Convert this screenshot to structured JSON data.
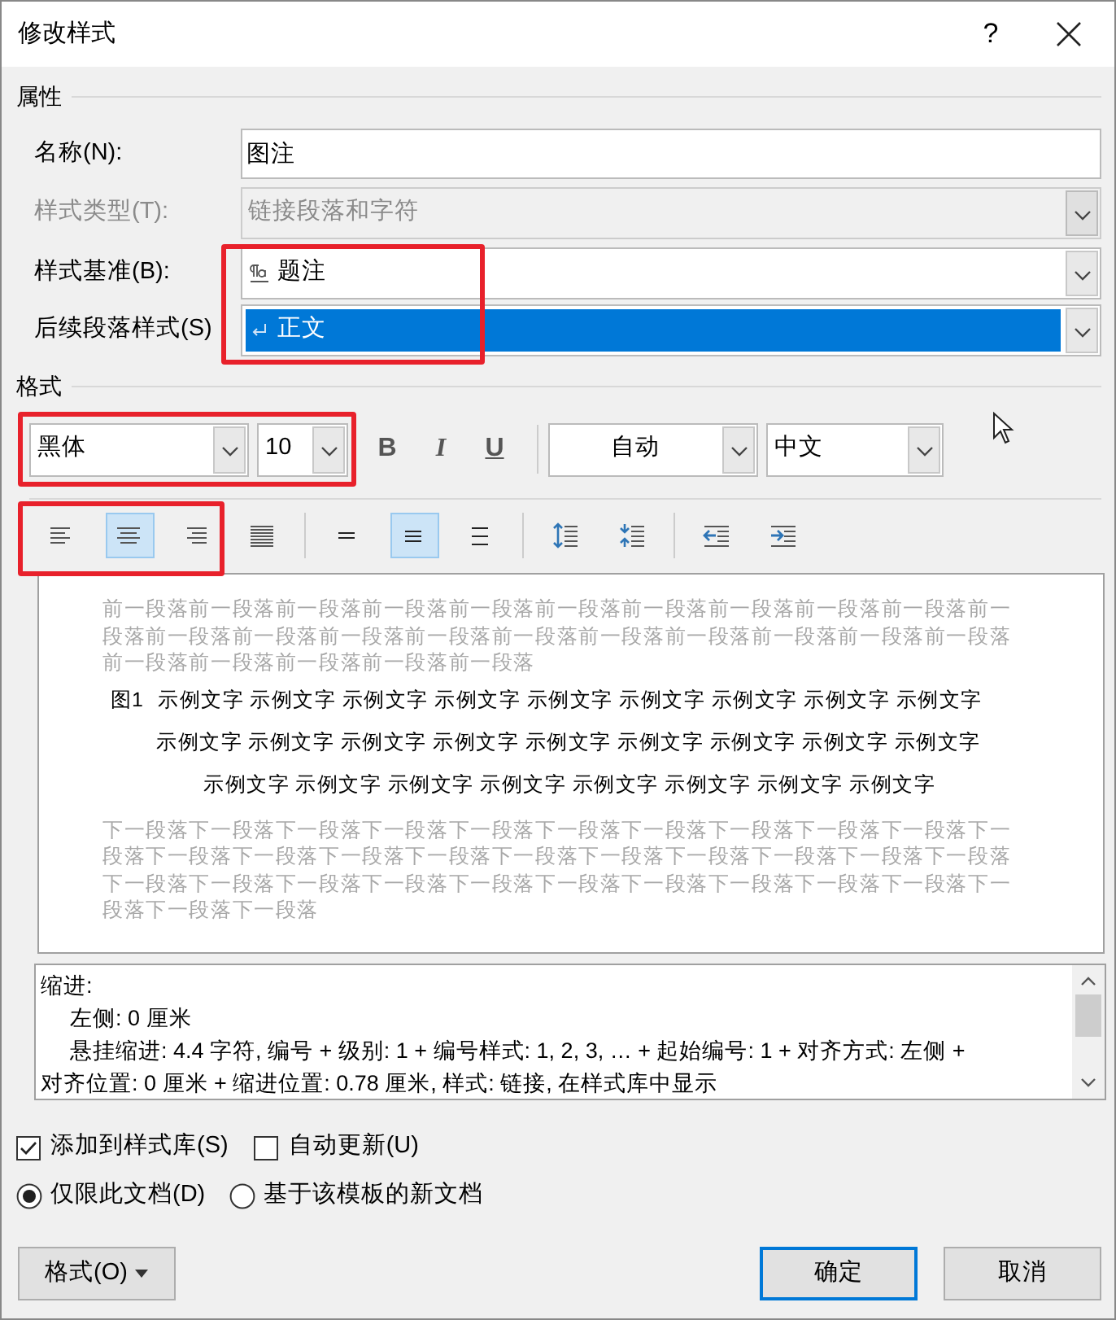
{
  "window": {
    "title": "修改样式",
    "help": "?"
  },
  "properties": {
    "heading": "属性",
    "name": {
      "label": "名称(N):",
      "value": "图注"
    },
    "style_type": {
      "label": "样式类型(T):",
      "value": "链接段落和字符",
      "disabled": true
    },
    "based_on": {
      "label": "样式基准(B):",
      "value": "题注",
      "selected": false
    },
    "next_style": {
      "label": "后续段落样式(S)",
      "value": "正文",
      "selected": true
    }
  },
  "formatting": {
    "heading": "格式",
    "font": "黑体",
    "size": "10",
    "style_buttons": [
      {
        "label": "B",
        "kind": "bold"
      },
      {
        "label": "I",
        "kind": "italic"
      },
      {
        "label": "U",
        "kind": "underline"
      }
    ],
    "font_color": "自动",
    "language": "中文",
    "paragraph_groups": [
      [
        {
          "kind": "left",
          "selected": false
        },
        {
          "kind": "center",
          "selected": true
        },
        {
          "kind": "right",
          "selected": false
        },
        {
          "kind": "justify",
          "selected": false
        }
      ],
      [
        {
          "kind": "single",
          "selected": false
        },
        {
          "kind": "onehalf",
          "selected": true
        },
        {
          "kind": "double",
          "selected": false
        }
      ],
      [
        {
          "kind": "spacemore",
          "selected": false
        },
        {
          "kind": "spaceless",
          "selected": false
        }
      ],
      [
        {
          "kind": "outdent",
          "selected": false
        },
        {
          "kind": "indent",
          "selected": false
        }
      ]
    ]
  },
  "preview": {
    "previous_lines": [
      "前一段落前一段落前一段落前一段落前一段落前一段落前一段落前一段落前一段落前一段落前一",
      "段落前一段落前一段落前一段落前一段落前一段落前一段落前一段落前一段落前一段落前一段落",
      "前一段落前一段落前一段落前一段落前一段落"
    ],
    "caption_number": "图1",
    "sample_lines": [
      "示例文字 示例文字 示例文字 示例文字 示例文字 示例文字 示例文字 示例文字 示例文字",
      "示例文字 示例文字 示例文字 示例文字 示例文字 示例文字 示例文字 示例文字 示例文字",
      "示例文字 示例文字 示例文字 示例文字 示例文字 示例文字 示例文字 示例文字"
    ],
    "next_lines": [
      "下一段落下一段落下一段落下一段落下一段落下一段落下一段落下一段落下一段落下一段落下一",
      "段落下一段落下一段落下一段落下一段落下一段落下一段落下一段落下一段落下一段落下一段落",
      "下一段落下一段落下一段落下一段落下一段落下一段落下一段落下一段落下一段落下一段落下一",
      "段落下一段落下一段落"
    ]
  },
  "description": [
    {
      "text": "缩进:",
      "indented": false
    },
    {
      "text": "左侧:  0 厘米",
      "indented": true
    },
    {
      "text": "悬挂缩进: 4.4 字符, 编号 + 级别: 1 + 编号样式: 1, 2, 3, … + 起始编号: 1 + 对齐方式: 左侧 +",
      "indented": true
    },
    {
      "text": "对齐位置:  0 厘米 + 缩进位置:  0.78 厘米, 样式: 链接, 在样式库中显示",
      "indented": false
    }
  ],
  "checkboxes": [
    {
      "label": "添加到样式库(S)",
      "checked": true
    },
    {
      "label": "自动更新(U)",
      "checked": false
    }
  ],
  "radios": [
    {
      "label": "仅限此文档(D)",
      "selected": true
    },
    {
      "label": "基于该模板的新文档",
      "selected": false
    }
  ],
  "format_button": {
    "label": "格式(O)"
  },
  "buttons": [
    {
      "label": "确定",
      "default": true
    },
    {
      "label": "取消",
      "default": false
    }
  ]
}
